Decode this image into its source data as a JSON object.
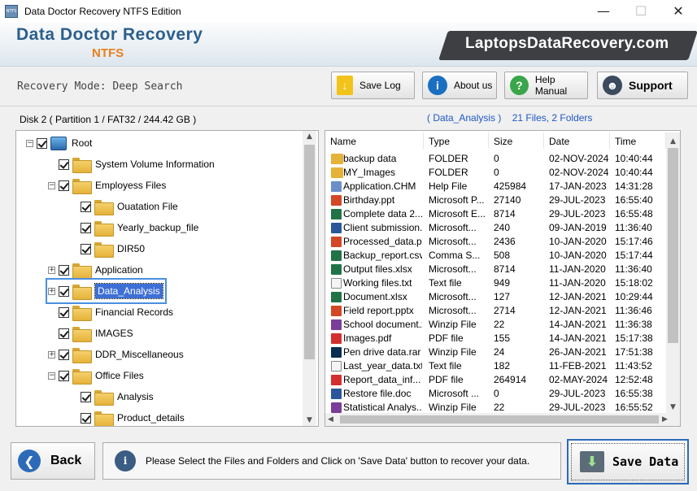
{
  "window": {
    "title": "Data Doctor Recovery NTFS Edition",
    "icon_text": "NTFS",
    "minimize": "—",
    "maximize": "☐",
    "close": "✕"
  },
  "header": {
    "brand": "Data Doctor Recovery",
    "edition": "NTFS",
    "banner": "LaptopsDataRecovery.com"
  },
  "toolbar": {
    "mode": "Recovery Mode: Deep Search",
    "save_log": "Save Log",
    "about": "About us",
    "help": "Help Manual",
    "support": "Support"
  },
  "left": {
    "disk": "Disk 2 ( Partition 1 / FAT32 / 244.42 GB )",
    "tree": [
      {
        "label": "Root",
        "expander": "−"
      },
      {
        "label": "System Volume Information",
        "expander": ""
      },
      {
        "label": "Employess Files",
        "expander": "−"
      },
      {
        "label": "Ouatation File",
        "expander": ""
      },
      {
        "label": "Yearly_backup_file",
        "expander": ""
      },
      {
        "label": "DIR50",
        "expander": ""
      },
      {
        "label": "Application",
        "expander": "+"
      },
      {
        "label": "Data_Analysis",
        "expander": "+"
      },
      {
        "label": "Financial Records",
        "expander": ""
      },
      {
        "label": "IMAGES",
        "expander": ""
      },
      {
        "label": "DDR_Miscellaneous",
        "expander": "+"
      },
      {
        "label": "Office Files",
        "expander": "−"
      },
      {
        "label": "Analysis",
        "expander": ""
      },
      {
        "label": "Product_details",
        "expander": ""
      }
    ]
  },
  "right": {
    "folder": "( Data_Analysis )",
    "counts": "21 Files, 2 Folders",
    "columns": [
      "Name",
      "Type",
      "Size",
      "Date",
      "Time"
    ],
    "rows": [
      [
        "backup data",
        "FOLDER",
        "0",
        "02-NOV-2024",
        "10:40:44",
        "folder"
      ],
      [
        "MY_Images",
        "FOLDER",
        "0",
        "02-NOV-2024",
        "10:40:44",
        "folder"
      ],
      [
        "Application.CHM",
        "Help File",
        "425984",
        "17-JAN-2023",
        "14:31:28",
        "chm"
      ],
      [
        "Birthday.ppt",
        "Microsoft P...",
        "27140",
        "29-JUL-2023",
        "16:55:40",
        "ppt"
      ],
      [
        "Complete data 2...",
        "Microsoft E...",
        "8714",
        "29-JUL-2023",
        "16:55:48",
        "xls"
      ],
      [
        "Client submission.do",
        "Microsoft...",
        "240",
        "09-JAN-2019",
        "11:36:40",
        "doc"
      ],
      [
        "Processed_data.ppt",
        "Microsoft...",
        "2436",
        "10-JAN-2020",
        "15:17:46",
        "ppt"
      ],
      [
        "Backup_report.csv",
        "Comma S...",
        "508",
        "10-JAN-2020",
        "15:17:44",
        "xls"
      ],
      [
        "Output files.xlsx",
        "Microsoft...",
        "8714",
        "11-JAN-2020",
        "11:36:40",
        "xls"
      ],
      [
        "Working files.txt",
        "Text file",
        "949",
        "11-JAN-2020",
        "15:18:02",
        "txt"
      ],
      [
        "Document.xlsx",
        "Microsoft...",
        "127",
        "12-JAN-2021",
        "10:29:44",
        "xls"
      ],
      [
        "Field report.pptx",
        "Microsoft...",
        "2714",
        "12-JAN-2021",
        "11:36:46",
        "ppt"
      ],
      [
        "School document.zip",
        "Winzip File",
        "22",
        "14-JAN-2021",
        "11:36:38",
        "zip"
      ],
      [
        "Images.pdf",
        "PDF file",
        "155",
        "14-JAN-2021",
        "15:17:38",
        "pdf"
      ],
      [
        "Pen drive data.rar",
        "Winzip File",
        "24",
        "26-JAN-2021",
        "17:51:38",
        "psd"
      ],
      [
        "Last_year_data.txt",
        "Text file",
        "182",
        "11-FEB-2021",
        "11:43:52",
        "txt"
      ],
      [
        "Report_data_inf...",
        "PDF file",
        "264914",
        "02-MAY-2024",
        "12:52:48",
        "pdf"
      ],
      [
        "Restore file.doc",
        "Microsoft ...",
        "0",
        "29-JUL-2023",
        "16:55:38",
        "doc"
      ],
      [
        "Statistical Analys...",
        "Winzip File",
        "22",
        "29-JUL-2023",
        "16:55:52",
        "zip"
      ]
    ]
  },
  "bottom": {
    "back": "Back",
    "info": "Please Select the Files and Folders and Click on 'Save Data' button to recover your data.",
    "save": "Save Data"
  },
  "colors": {
    "brand": "#2b5f8d",
    "accent": "#e87e1c",
    "link": "#1f57c7",
    "selection": "#3d6fd6"
  }
}
